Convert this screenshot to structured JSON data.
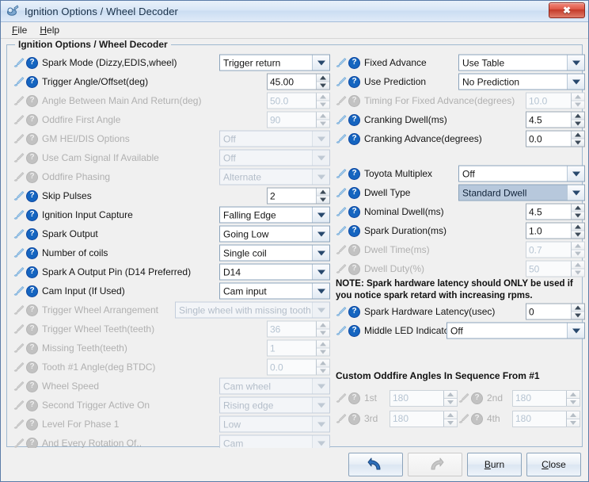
{
  "window": {
    "title": "Ignition Options / Wheel Decoder",
    "icon": "app-icon",
    "close_label": "✖"
  },
  "menubar": {
    "items": [
      {
        "label": "File",
        "mnemonic": "F"
      },
      {
        "label": "Help",
        "mnemonic": "H"
      }
    ]
  },
  "groupbox": {
    "title": "Ignition Options / Wheel Decoder"
  },
  "left_column": [
    {
      "label": "Spark Mode (Dizzy,EDIS,wheel)",
      "type": "combo",
      "value": "Trigger return",
      "enabled": true,
      "width": 140
    },
    {
      "label": "Trigger Angle/Offset(deg)",
      "type": "spin",
      "value": "45.00",
      "enabled": true,
      "width": 80
    },
    {
      "label": "Angle Between Main And Return(deg)",
      "type": "spin",
      "value": "50.0",
      "enabled": false,
      "width": 80
    },
    {
      "label": "Oddfire First Angle",
      "type": "spin",
      "value": "90",
      "enabled": false,
      "width": 80
    },
    {
      "label": "GM HEI/DIS Options",
      "type": "combo",
      "value": "Off",
      "enabled": false,
      "width": 140
    },
    {
      "label": "Use Cam Signal If Available",
      "type": "combo",
      "value": "Off",
      "enabled": false,
      "width": 140
    },
    {
      "label": "Oddfire Phasing",
      "type": "combo",
      "value": "Alternate",
      "enabled": false,
      "width": 140
    },
    {
      "label": "Skip Pulses",
      "type": "spin",
      "value": "2",
      "enabled": true,
      "width": 80
    },
    {
      "label": "Ignition Input Capture",
      "type": "combo",
      "value": "Falling Edge",
      "enabled": true,
      "width": 140
    },
    {
      "label": "Spark Output",
      "type": "combo",
      "value": "Going Low",
      "enabled": true,
      "width": 140
    },
    {
      "label": "Number of coils",
      "type": "combo",
      "value": "Single coil",
      "enabled": true,
      "width": 140
    },
    {
      "label": "Spark A Output Pin (D14 Preferred)",
      "type": "combo",
      "value": "D14",
      "enabled": true,
      "width": 140
    },
    {
      "label": "Cam Input (If Used)",
      "type": "combo",
      "value": "Cam input",
      "enabled": true,
      "width": 140
    },
    {
      "label": "Trigger Wheel Arrangement",
      "type": "combo",
      "value": "Single wheel with missing tooth",
      "enabled": false,
      "width": 196
    },
    {
      "label": "Trigger Wheel Teeth(teeth)",
      "type": "spin",
      "value": "36",
      "enabled": false,
      "width": 80
    },
    {
      "label": "Missing Teeth(teeth)",
      "type": "spin",
      "value": "1",
      "enabled": false,
      "width": 80
    },
    {
      "label": "Tooth #1 Angle(deg BTDC)",
      "type": "spin",
      "value": "0.0",
      "enabled": false,
      "width": 80
    },
    {
      "label": "Wheel Speed",
      "type": "combo",
      "value": "Cam wheel",
      "enabled": false,
      "width": 140
    },
    {
      "label": "Second Trigger Active On",
      "type": "combo",
      "value": "Rising edge",
      "enabled": false,
      "width": 140
    },
    {
      "label": "Level For Phase 1",
      "type": "combo",
      "value": "Low",
      "enabled": false,
      "width": 140
    },
    {
      "label": "And Every Rotation Of..",
      "type": "combo",
      "value": "Cam",
      "enabled": false,
      "width": 140
    }
  ],
  "right_column": [
    {
      "label": "Fixed Advance",
      "type": "combo",
      "value": "Use Table",
      "enabled": true,
      "width": 160
    },
    {
      "label": "Use Prediction",
      "type": "combo",
      "value": "No Prediction",
      "enabled": true,
      "width": 160
    },
    {
      "label": "Timing For Fixed Advance(degrees)",
      "type": "spin",
      "value": "10.0",
      "enabled": false,
      "width": 75
    },
    {
      "label": "Cranking Dwell(ms)",
      "type": "spin",
      "value": "4.5",
      "enabled": true,
      "width": 75
    },
    {
      "label": "Cranking Advance(degrees)",
      "type": "spin",
      "value": "0.0",
      "enabled": true,
      "width": 75
    },
    {
      "type": "gap"
    },
    {
      "label": "Toyota Multiplex",
      "type": "combo",
      "value": "Off",
      "enabled": true,
      "width": 160
    },
    {
      "label": "Dwell Type",
      "type": "combo",
      "value": "Standard Dwell",
      "enabled": true,
      "width": 160,
      "selected": true
    },
    {
      "label": "Nominal Dwell(ms)",
      "type": "spin",
      "value": "4.5",
      "enabled": true,
      "width": 75
    },
    {
      "label": "Spark Duration(ms)",
      "type": "spin",
      "value": "1.0",
      "enabled": true,
      "width": 75
    },
    {
      "label": "Dwell Time(ms)",
      "type": "spin",
      "value": "0.7",
      "enabled": false,
      "width": 75
    },
    {
      "label": "Dwell Duty(%)",
      "type": "spin",
      "value": "50",
      "enabled": false,
      "width": 75
    }
  ],
  "note": {
    "line1": "NOTE: Spark hardware latency should ONLY be used if",
    "line2": "you notice spark retard with increasing rpms."
  },
  "right_column_2": [
    {
      "label": "Spark Hardware Latency(usec)",
      "type": "spin",
      "value": "0",
      "enabled": true,
      "width": 75
    },
    {
      "label": "Middle LED Indicator",
      "type": "combo",
      "value": "Off",
      "enabled": true,
      "width": 175
    }
  ],
  "oddfire": {
    "title": "Custom Oddfire Angles In Sequence From #1",
    "fields": [
      {
        "label": "1st",
        "value": "180",
        "enabled": false
      },
      {
        "label": "2nd",
        "value": "180",
        "enabled": false
      },
      {
        "label": "3rd",
        "value": "180",
        "enabled": false
      },
      {
        "label": "4th",
        "value": "180",
        "enabled": false
      }
    ]
  },
  "buttons": [
    {
      "name": "undo-button",
      "label": "",
      "icon": "undo-arrow-icon",
      "enabled": true
    },
    {
      "name": "redo-button",
      "label": "",
      "icon": "redo-arrow-icon",
      "enabled": false
    },
    {
      "name": "burn-button",
      "label": "Burn",
      "mnemonic": "B",
      "enabled": true
    },
    {
      "name": "close-button",
      "label": "Close",
      "mnemonic": "C",
      "enabled": true
    }
  ],
  "colors": {
    "titlebar": "#d8e6f6",
    "close_button": "#c43a29",
    "badge_enabled": "#1565c0",
    "badge_disabled": "#c2c2c2",
    "selection": "#b7c8dc",
    "window_bg": "#f0f0f0"
  }
}
